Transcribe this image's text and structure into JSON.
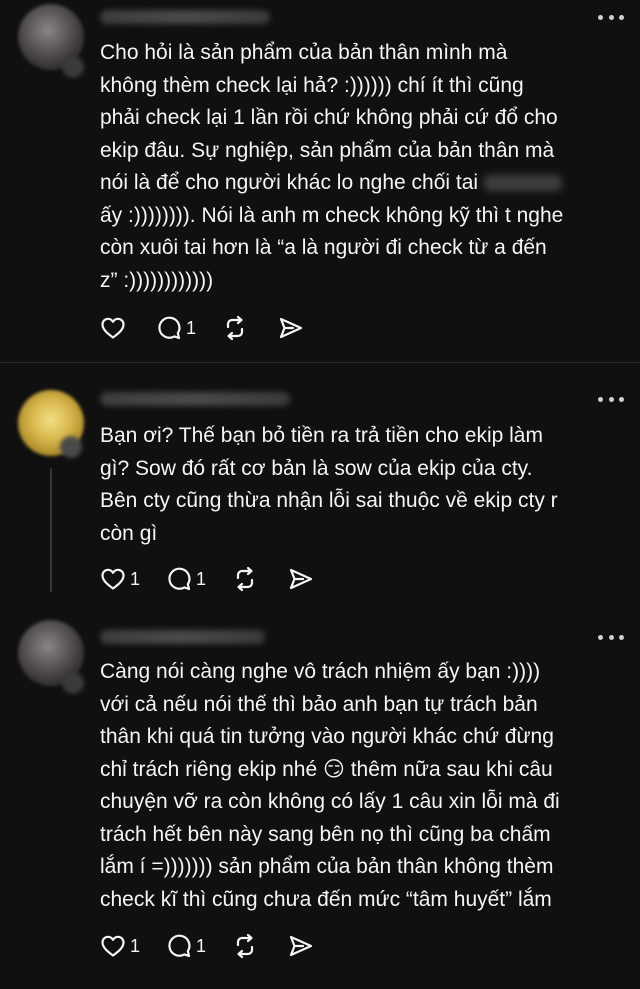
{
  "posts": [
    {
      "text_before": "Cho hỏi là sản phẩm của bản thân mình mà\nkhông thèm check lại hả? :)))))) chí ít thì cũng\nphải check lại 1 lần rồi chứ không phải cứ đổ cho\nekip đâu. Sự nghiệp, sản phẩm của bản thân mà\nnói là để cho người khác lo nghe chối tai ",
      "text_after": "\nấy :)))))))). Nói là anh m check không kỹ thì t nghe\ncòn xuôi tai hơn là “a là người đi check từ a đến\nz” :))))))))))))",
      "likes": "",
      "comments": "1",
      "reposts": "",
      "shares": ""
    },
    {
      "text": "Bạn ơi? Thế bạn bỏ tiền ra trả tiền cho ekip làm\ngì? Sow đó rất cơ bản là sow của ekip của cty.\nBên cty cũng thừa nhận lỗi sai thuộc về ekip cty r\ncòn gì",
      "likes": "1",
      "comments": "1",
      "reposts": "",
      "shares": ""
    },
    {
      "text_before": "Càng nói càng nghe vô trách nhiệm ấy bạn :))))\nvới cả nếu nói thế thì bảo anh bạn tự trách bản\nthân khi quá tin tưởng vào người khác chứ đừng\nchỉ trách riêng ekip nhé ",
      "emoji": "😏",
      "text_after": "  thêm nữa sau khi câu\nchuyện vỡ ra còn không có lấy 1 câu xin lỗi mà đi\ntrách hết bên này sang bên nọ thì cũng ba chấm\nlắm í =))))))) sản phẩm của bản thân không thèm\ncheck kĩ thì cũng chưa đến mức “tâm huyết” lắm",
      "likes": "1",
      "comments": "1",
      "reposts": "",
      "shares": ""
    }
  ],
  "icons": {
    "like": "heart-icon",
    "comment": "comment-bubble-icon",
    "repost": "repost-icon",
    "share": "send-icon",
    "more": "more-dots-icon"
  },
  "colors": {
    "background": "#101010",
    "text": "#f3f5f7",
    "thread_line": "#333638"
  }
}
